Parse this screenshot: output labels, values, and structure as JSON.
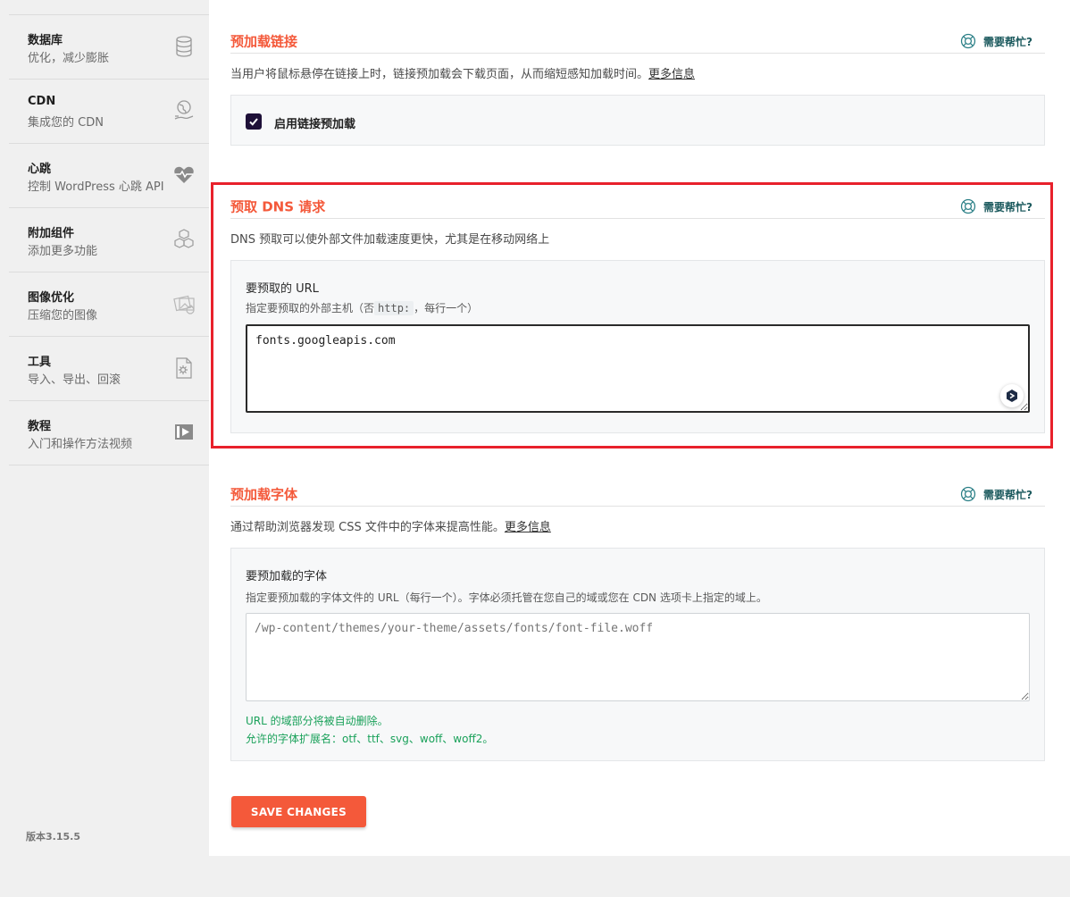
{
  "sidebar": {
    "items": [
      {
        "title": "数据库",
        "subtitle": "优化，减少膨胀",
        "icon": "database-icon"
      },
      {
        "title": "CDN",
        "subtitle": "集成您的 CDN",
        "icon": "cdn-globe-hand-icon"
      },
      {
        "title": "心跳",
        "subtitle": "控制 WordPress 心跳 API",
        "icon": "heartbeat-icon"
      },
      {
        "title": "附加组件",
        "subtitle": "添加更多功能",
        "icon": "addons-cubes-icon"
      },
      {
        "title": "图像优化",
        "subtitle": "压缩您的图像",
        "icon": "image-optimization-icon"
      },
      {
        "title": "工具",
        "subtitle": "导入、导出、回滚",
        "icon": "tools-icon"
      },
      {
        "title": "教程",
        "subtitle": "入门和操作方法视频",
        "icon": "video-play-icon"
      }
    ],
    "version": "版本3.15.5"
  },
  "help_label": "需要帮忙?",
  "sections": {
    "link_preload": {
      "title": "预加载链接",
      "description": "当用户将鼠标悬停在链接上时，链接预加载会下载页面，从而缩短感知加载时间。",
      "more_info": "更多信息",
      "checkbox_label": "启用链接预加载",
      "checkbox_checked": true
    },
    "dns_prefetch": {
      "title": "预取 DNS 请求",
      "description": "DNS 预取可以使外部文件加载速度更快，尤其是在移动网络上",
      "field_title": "要预取的 URL",
      "hint_before": "指定要预取的外部主机（否",
      "hint_code": "http:",
      "hint_after": "，每行一个）",
      "value": "fonts.googleapis.com"
    },
    "font_preload": {
      "title": "预加载字体",
      "description": "通过帮助浏览器发现 CSS 文件中的字体来提高性能。",
      "more_info": "更多信息",
      "field_title": "要预加载的字体",
      "hint": "指定要预加载的字体文件的 URL（每行一个）。字体必须托管在您自己的域或您在 CDN 选项卡上指定的域上。",
      "placeholder": "/wp-content/themes/your-theme/assets/fonts/font-file.woff",
      "note1": "URL 的域部分将被自动删除。",
      "note2": "允许的字体扩展名：otf、ttf、svg、woff、woff2。"
    }
  },
  "save_button": "SAVE CHANGES",
  "colors": {
    "accent": "#f4593a",
    "highlight_border": "#e8212b",
    "help_text": "#1c5a5e",
    "checkbox": "#1e1038",
    "note_green": "#1aa15a"
  }
}
